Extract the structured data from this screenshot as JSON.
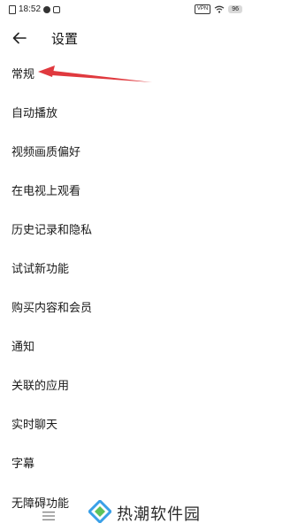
{
  "status_bar": {
    "time": "18:52",
    "vpn_label": "VPN",
    "battery_level": "96",
    "icons": [
      "sim-icon",
      "notification-dot-icon",
      "message-icon",
      "wifi-icon",
      "battery-icon"
    ]
  },
  "header": {
    "title": "设置",
    "back_icon": "arrow-left-icon"
  },
  "settings": {
    "items": [
      {
        "label": "常规"
      },
      {
        "label": "自动播放"
      },
      {
        "label": "视频画质偏好"
      },
      {
        "label": "在电视上观看"
      },
      {
        "label": "历史记录和隐私"
      },
      {
        "label": "试试新功能"
      },
      {
        "label": "购买内容和会员"
      },
      {
        "label": "通知"
      },
      {
        "label": "关联的应用"
      },
      {
        "label": "实时聊天"
      },
      {
        "label": "字幕"
      }
    ],
    "partial_item": "无障碍功能"
  },
  "annotation": {
    "color": "#e0393e",
    "target": "常规"
  },
  "watermark": {
    "text": "热潮软件园",
    "logo_colors": [
      "#3aa0e8",
      "#5cc35c"
    ]
  }
}
